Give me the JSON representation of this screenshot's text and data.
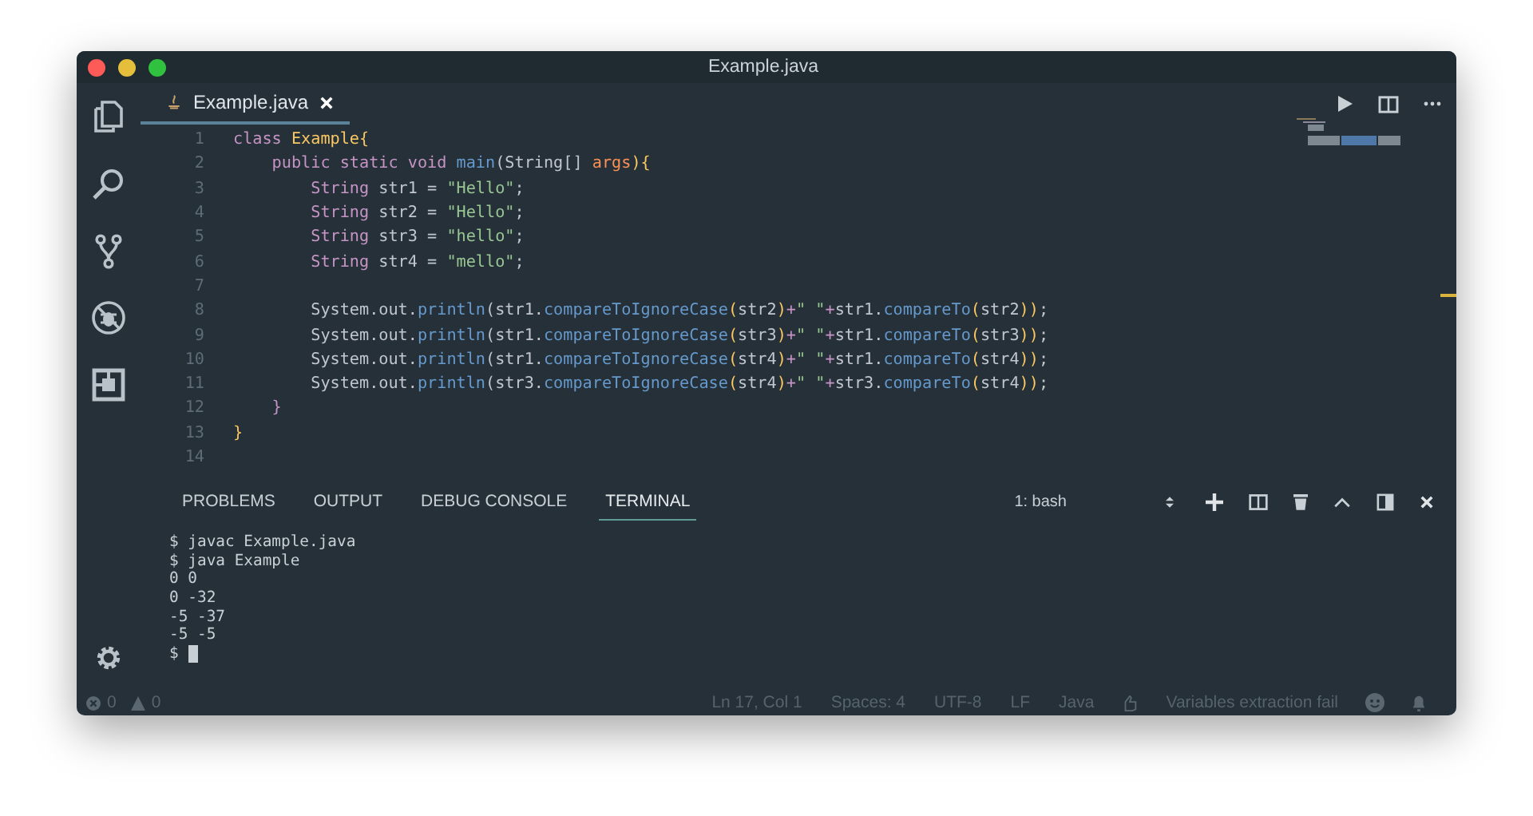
{
  "window": {
    "title": "Example.java"
  },
  "editor_tabs": [
    {
      "label": "Example.java",
      "selected": true
    }
  ],
  "code": {
    "lines": [
      {
        "number": "1",
        "tokens": [
          {
            "kind": "keyword",
            "text": "class "
          },
          {
            "kind": "type",
            "text": "Example"
          },
          {
            "kind": "bracket",
            "text": "{"
          }
        ]
      },
      {
        "number": "2",
        "tokens": [
          {
            "kind": "keyword",
            "text": "    public static void "
          },
          {
            "kind": "method",
            "text": "main"
          },
          {
            "kind": "plain",
            "text": "(String[] "
          },
          {
            "kind": "param",
            "text": "args"
          },
          {
            "kind": "bracket",
            "text": "){"
          }
        ]
      },
      {
        "number": "3",
        "tokens": [
          {
            "kind": "keyword",
            "text": "        String "
          },
          {
            "kind": "plain",
            "text": "str1 = "
          },
          {
            "kind": "string",
            "text": "\"Hello\""
          },
          {
            "kind": "plain",
            "text": ";"
          }
        ]
      },
      {
        "number": "4",
        "tokens": [
          {
            "kind": "keyword",
            "text": "        String "
          },
          {
            "kind": "plain",
            "text": "str2 = "
          },
          {
            "kind": "string",
            "text": "\"Hello\""
          },
          {
            "kind": "plain",
            "text": ";"
          }
        ]
      },
      {
        "number": "5",
        "tokens": [
          {
            "kind": "keyword",
            "text": "        String "
          },
          {
            "kind": "plain",
            "text": "str3 = "
          },
          {
            "kind": "string",
            "text": "\"hello\""
          },
          {
            "kind": "plain",
            "text": ";"
          }
        ]
      },
      {
        "number": "6",
        "tokens": [
          {
            "kind": "keyword",
            "text": "        String "
          },
          {
            "kind": "plain",
            "text": "str4 = "
          },
          {
            "kind": "string",
            "text": "\"mello\""
          },
          {
            "kind": "plain",
            "text": ";"
          }
        ]
      },
      {
        "number": "7"
      },
      {
        "number": "8",
        "tokens": [
          {
            "kind": "plain",
            "text": "        System.out."
          },
          {
            "kind": "method",
            "text": "println"
          },
          {
            "kind": "plain",
            "text": "(str1."
          },
          {
            "kind": "method",
            "text": "compareToIgnoreCase"
          },
          {
            "kind": "bracket",
            "text": "("
          },
          {
            "kind": "plain",
            "text": "str2"
          },
          {
            "kind": "bracket",
            "text": ")"
          },
          {
            "kind": "keyword",
            "text": "+"
          },
          {
            "kind": "string",
            "text": "\" \""
          },
          {
            "kind": "keyword",
            "text": "+"
          },
          {
            "kind": "plain",
            "text": "str1."
          },
          {
            "kind": "method",
            "text": "compareTo"
          },
          {
            "kind": "bracket",
            "text": "("
          },
          {
            "kind": "plain",
            "text": "str2"
          },
          {
            "kind": "bracket",
            "text": "))"
          },
          {
            "kind": "plain",
            "text": ";"
          }
        ]
      },
      {
        "number": "9",
        "tokens": [
          {
            "kind": "plain",
            "text": "        System.out."
          },
          {
            "kind": "method",
            "text": "println"
          },
          {
            "kind": "plain",
            "text": "(str1."
          },
          {
            "kind": "method",
            "text": "compareToIgnoreCase"
          },
          {
            "kind": "bracket",
            "text": "("
          },
          {
            "kind": "plain",
            "text": "str3"
          },
          {
            "kind": "bracket",
            "text": ")"
          },
          {
            "kind": "keyword",
            "text": "+"
          },
          {
            "kind": "string",
            "text": "\" \""
          },
          {
            "kind": "keyword",
            "text": "+"
          },
          {
            "kind": "plain",
            "text": "str1."
          },
          {
            "kind": "method",
            "text": "compareTo"
          },
          {
            "kind": "bracket",
            "text": "("
          },
          {
            "kind": "plain",
            "text": "str3"
          },
          {
            "kind": "bracket",
            "text": "))"
          },
          {
            "kind": "plain",
            "text": ";"
          }
        ]
      },
      {
        "number": "10",
        "tokens": [
          {
            "kind": "plain",
            "text": "        System.out."
          },
          {
            "kind": "method",
            "text": "println"
          },
          {
            "kind": "plain",
            "text": "(str1."
          },
          {
            "kind": "method",
            "text": "compareToIgnoreCase"
          },
          {
            "kind": "bracket",
            "text": "("
          },
          {
            "kind": "plain",
            "text": "str4"
          },
          {
            "kind": "bracket",
            "text": ")"
          },
          {
            "kind": "keyword",
            "text": "+"
          },
          {
            "kind": "string",
            "text": "\" \""
          },
          {
            "kind": "keyword",
            "text": "+"
          },
          {
            "kind": "plain",
            "text": "str1."
          },
          {
            "kind": "method",
            "text": "compareTo"
          },
          {
            "kind": "bracket",
            "text": "("
          },
          {
            "kind": "plain",
            "text": "str4"
          },
          {
            "kind": "bracket",
            "text": "))"
          },
          {
            "kind": "plain",
            "text": ";"
          }
        ]
      },
      {
        "number": "11",
        "tokens": [
          {
            "kind": "plain",
            "text": "        System.out."
          },
          {
            "kind": "method",
            "text": "println"
          },
          {
            "kind": "plain",
            "text": "(str3."
          },
          {
            "kind": "method",
            "text": "compareToIgnoreCase"
          },
          {
            "kind": "bracket",
            "text": "("
          },
          {
            "kind": "plain",
            "text": "str4"
          },
          {
            "kind": "bracket",
            "text": ")"
          },
          {
            "kind": "keyword",
            "text": "+"
          },
          {
            "kind": "string",
            "text": "\" \""
          },
          {
            "kind": "keyword",
            "text": "+"
          },
          {
            "kind": "plain",
            "text": "str3."
          },
          {
            "kind": "method",
            "text": "compareTo"
          },
          {
            "kind": "bracket",
            "text": "("
          },
          {
            "kind": "plain",
            "text": "str4"
          },
          {
            "kind": "bracket",
            "text": "))"
          },
          {
            "kind": "plain",
            "text": ";"
          }
        ]
      },
      {
        "number": "12",
        "tokens": [
          {
            "kind": "keyword",
            "text": "    }"
          }
        ]
      },
      {
        "number": "13",
        "tokens": [
          {
            "kind": "type",
            "text": "}"
          }
        ]
      },
      {
        "number": "14"
      }
    ]
  },
  "panel": {
    "tabs": [
      {
        "label": "PROBLEMS",
        "selected": false
      },
      {
        "label": "OUTPUT",
        "selected": false
      },
      {
        "label": "DEBUG CONSOLE",
        "selected": false
      },
      {
        "label": "TERMINAL",
        "selected": true
      }
    ],
    "terminal_select": "1: bash",
    "terminal_lines": [
      "$ javac Example.java",
      "$ java Example",
      "0 0",
      "0 -32",
      "-5 -37",
      "-5 -5"
    ],
    "prompt": "$"
  },
  "status_bar": {
    "errors": "0",
    "warnings": "0",
    "items": [
      "Ln 17, Col 1",
      "Spaces: 4",
      "UTF-8",
      "LF",
      "Java"
    ],
    "message": "Variables extraction fail"
  }
}
